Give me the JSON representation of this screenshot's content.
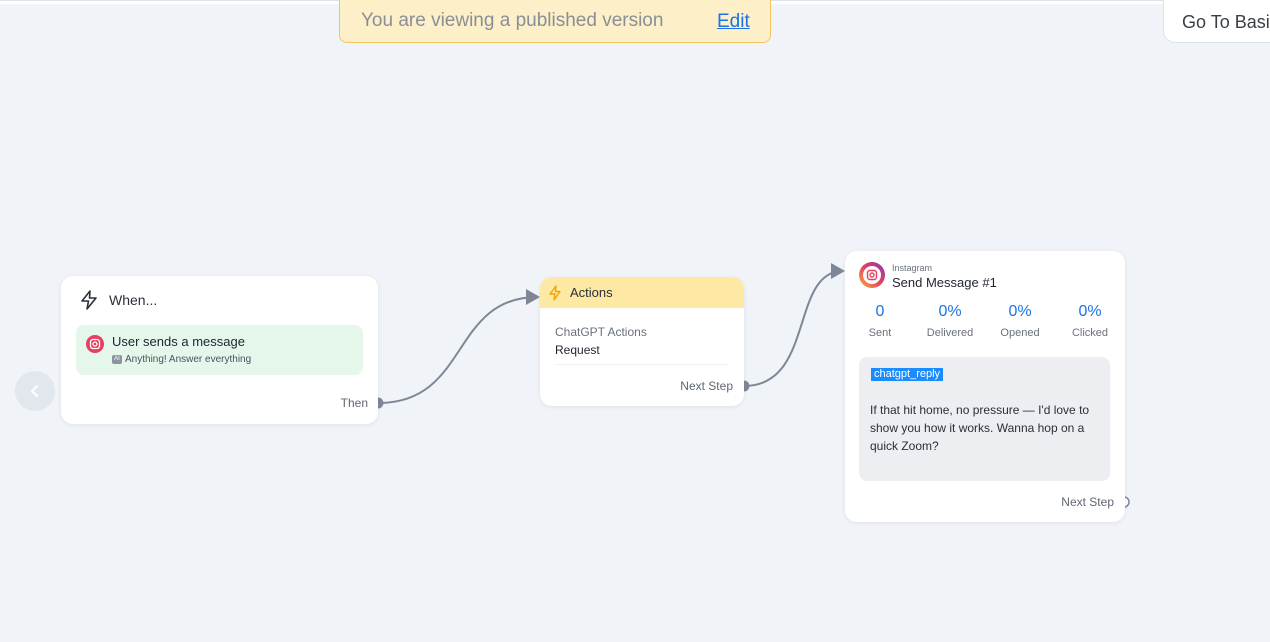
{
  "banner": {
    "text": "You are viewing a published version",
    "edit_label": "Edit"
  },
  "go_to_basic_label": "Go To Basi",
  "trigger": {
    "title": "When...",
    "event_title": "User sends a message",
    "event_subtitle": "Anything! Answer everything",
    "then_label": "Then"
  },
  "actions": {
    "header": "Actions",
    "action_name": "ChatGPT Actions",
    "action_type": "Request",
    "next_step_label": "Next Step"
  },
  "message": {
    "platform": "Instagram",
    "title": "Send Message #1",
    "stats": [
      {
        "value": "0",
        "label": "Sent"
      },
      {
        "value": "0%",
        "label": "Delivered"
      },
      {
        "value": "0%",
        "label": "Opened"
      },
      {
        "value": "0%",
        "label": "Clicked"
      }
    ],
    "variable_tag": "chatgpt_reply",
    "body": "If that hit home, no pressure — I'd love to show you how it works. Wanna hop on a quick Zoom?",
    "next_step_label": "Next Step"
  },
  "colors": {
    "accent": "#1a73e8",
    "banner_bg": "#fdefc7",
    "trigger_event_bg": "#e4f7ea",
    "actions_header_bg": "#fde9a3",
    "canvas_bg": "#f0f3f7"
  },
  "icons": {
    "trigger": "lightning-outline-icon",
    "actions": "lightning-filled-icon",
    "platform": "instagram-icon",
    "back": "chevron-left-icon"
  }
}
